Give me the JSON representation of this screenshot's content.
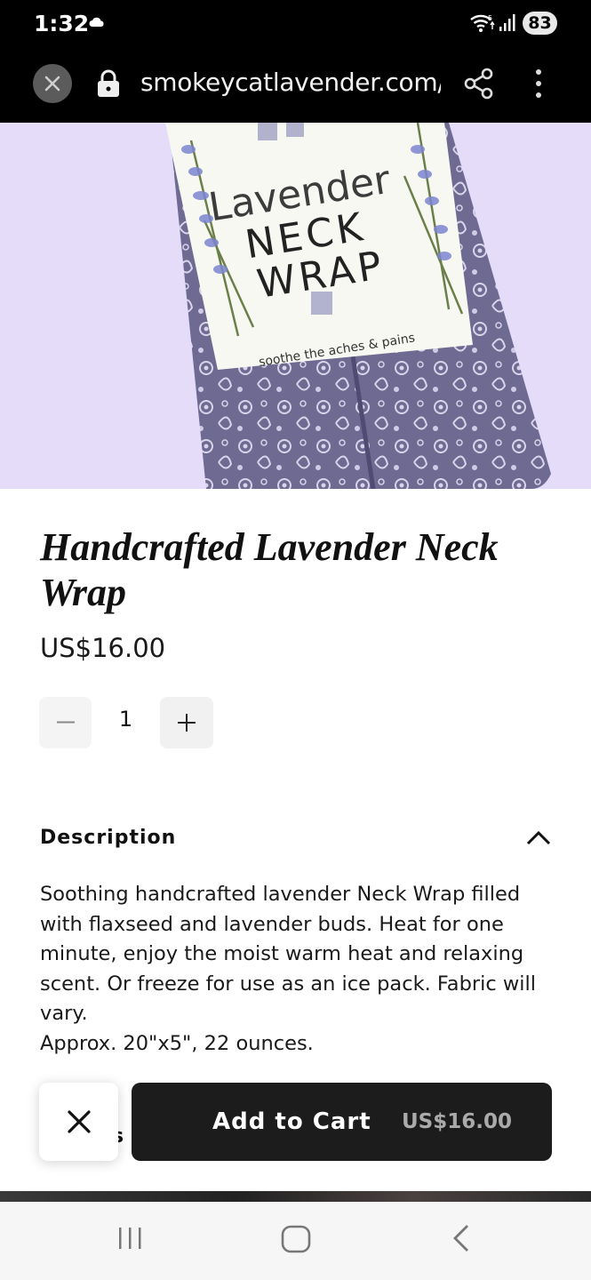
{
  "status_bar": {
    "time": "1:32",
    "battery": "83",
    "icons": [
      "cloud-icon",
      "wifi-icon",
      "signal-icon",
      "battery-icon"
    ]
  },
  "browser": {
    "url": "smokeycatlavender.com/p",
    "icons": [
      "close-icon",
      "lock-icon",
      "share-icon",
      "more-vert-icon"
    ]
  },
  "hero": {
    "package_line1": "Lavender",
    "package_line2": "NECK",
    "package_line3": "WRAP",
    "package_tagline": "soothe the aches & pains",
    "background_color": "#e4dcf9"
  },
  "product": {
    "title": "Handcrafted Lavender Neck Wrap",
    "price": "US$16.00",
    "quantity": "1"
  },
  "description": {
    "header": "Description",
    "text_line1": "Soothing handcrafted lavender Neck Wrap filled with flaxseed and lavender buds. Heat for one minute, enjoy the moist warm heat and relaxing scent. Or freeze for use as an ice pack. Fabric will vary.",
    "text_line2": "Approx. 20\"x5\", 22 ounces."
  },
  "sticky_cart": {
    "partial_label": "s",
    "button_label": "Add to Cart",
    "button_price": "US$16.00",
    "dark_color": "#1c1c1c"
  },
  "nav_bar": {
    "icons": [
      "recent-apps-icon",
      "home-icon",
      "back-icon"
    ]
  }
}
